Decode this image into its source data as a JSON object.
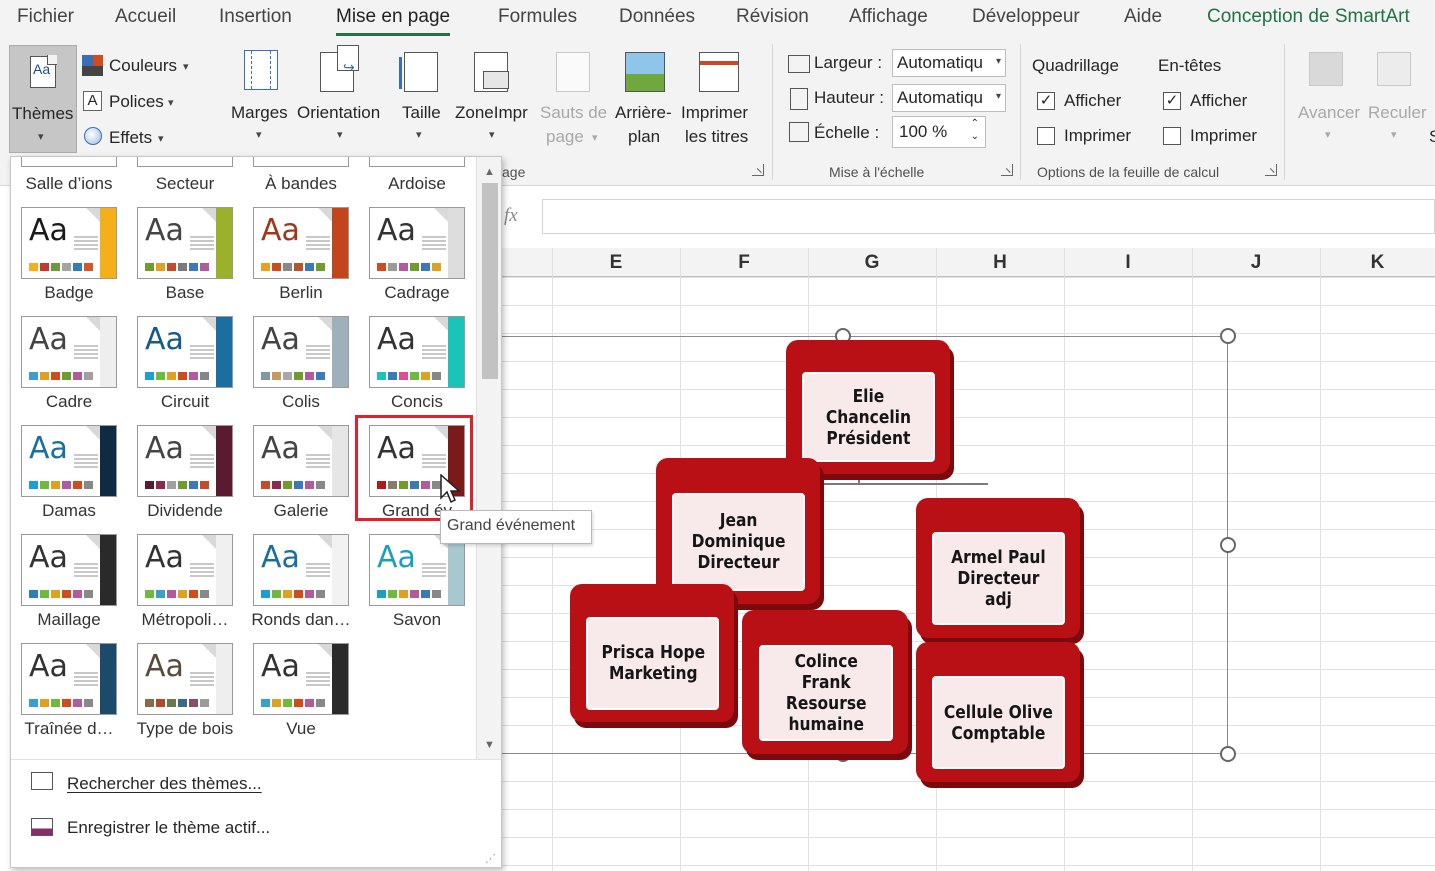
{
  "tabs": [
    {
      "label": "Fichier"
    },
    {
      "label": "Accueil"
    },
    {
      "label": "Insertion"
    },
    {
      "label": "Mise en page"
    },
    {
      "label": "Formules"
    },
    {
      "label": "Données"
    },
    {
      "label": "Révision"
    },
    {
      "label": "Affichage"
    },
    {
      "label": "Développeur"
    },
    {
      "label": "Aide"
    },
    {
      "label": "Conception de SmartArt"
    }
  ],
  "ribbon": {
    "themes": {
      "label": "Thèmes",
      "colors": "Couleurs",
      "fonts": "Polices",
      "effects": "Effets"
    },
    "page_setup": {
      "margins": "Marges",
      "orientation": "Orientation",
      "size": "Taille",
      "print_area": "ZoneImpr",
      "breaks_1": "Sauts de",
      "breaks_2": "page",
      "background_1": "Arrière-",
      "background_2": "plan",
      "print_titles_1": "Imprimer",
      "print_titles_2": "les titres",
      "group_label_tail": "age"
    },
    "scale": {
      "width_label": "Largeur :",
      "width_value": "Automatiqu",
      "height_label": "Hauteur :",
      "height_value": "Automatiqu",
      "scale_label": "Échelle :",
      "scale_value": "100 %",
      "group_label": "Mise à l'échelle"
    },
    "sheet_options": {
      "gridlines": "Quadrillage",
      "headings": "En-têtes",
      "view": "Afficher",
      "print": "Imprimer",
      "group_label": "Options de la feuille de calcul",
      "gridlines_view_checked": true,
      "gridlines_print_checked": false,
      "headings_view_checked": true,
      "headings_print_checked": false
    },
    "arrange": {
      "forward": "Avancer",
      "backward": "Reculer",
      "cut_letter": "S"
    }
  },
  "formula_bar": {
    "fx": "fx",
    "value": ""
  },
  "columns": [
    "E",
    "F",
    "G",
    "H",
    "I",
    "J",
    "K"
  ],
  "gallery": {
    "partial_row": [
      "Salle d’ions",
      "Secteur",
      "À bandes",
      "Ardoise"
    ],
    "themes": [
      {
        "name": "Badge",
        "aa_color": "#1a1a1a",
        "edge": "#f4b01a",
        "swatches": [
          "#f4b01a",
          "#c43b2b",
          "#6d9a3c",
          "#a4a4a4",
          "#2f7fb6",
          "#d7552a"
        ]
      },
      {
        "name": "Base",
        "aa_color": "#444444",
        "edge": "#9ab22a",
        "swatches": [
          "#6f9c2c",
          "#e0a020",
          "#c44b2b",
          "#7a7a7a",
          "#3a7ab8",
          "#b15b9e"
        ]
      },
      {
        "name": "Berlin",
        "aa_color": "#a0371c",
        "edge": "#c3451c",
        "swatches": [
          "#e8a020",
          "#d04c1c",
          "#888888",
          "#b4572a",
          "#3a7ab8",
          "#6f9c2c"
        ]
      },
      {
        "name": "Cadrage",
        "aa_color": "#333333",
        "edge": "#dddddd",
        "swatches": [
          "#d04c1c",
          "#9a9a9a",
          "#b15b9e",
          "#6f9c2c",
          "#3a7ab8",
          "#e0a020"
        ]
      },
      {
        "name": "Cadre",
        "aa_color": "#444444",
        "edge": "#eeeeee",
        "swatches": [
          "#3aa0c8",
          "#e0a020",
          "#d04c1c",
          "#6f9c2c",
          "#b15b9e",
          "#a0a0a0"
        ]
      },
      {
        "name": "Circuit",
        "aa_color": "#145a8c",
        "edge": "#1b6fa0",
        "swatches": [
          "#1b9ed6",
          "#6fb93f",
          "#e0a020",
          "#d04c1c",
          "#b15b9e",
          "#888888"
        ]
      },
      {
        "name": "Colis",
        "aa_color": "#444444",
        "edge": "#9eb0ba",
        "swatches": [
          "#7e9aa8",
          "#c69a5c",
          "#a8a8a8",
          "#6f9c2c",
          "#b15b9e",
          "#3a7ab8"
        ]
      },
      {
        "name": "Concis",
        "aa_color": "#333333",
        "edge": "#1cc3b8",
        "swatches": [
          "#1cc3b8",
          "#3a7ab8",
          "#e04c8c",
          "#6fb93f",
          "#e0a020",
          "#888888"
        ]
      },
      {
        "name": "Damas",
        "aa_color": "#1b6fa0",
        "edge": "#0f2b44",
        "swatches": [
          "#1b9ed6",
          "#6fb93f",
          "#e0a020",
          "#b15b9e",
          "#d04c1c",
          "#888888"
        ]
      },
      {
        "name": "Dividende",
        "aa_color": "#444444",
        "edge": "#5a1a30",
        "swatches": [
          "#5a1a30",
          "#8a2b4c",
          "#a0a0a0",
          "#6f9c2c",
          "#3a7ab8",
          "#c44b2b"
        ]
      },
      {
        "name": "Galerie",
        "aa_color": "#444444",
        "edge": "#e6e6e6",
        "swatches": [
          "#c44b2b",
          "#8a2b4c",
          "#6f9c2c",
          "#3a7ab8",
          "#b15b9e",
          "#888888"
        ]
      },
      {
        "name": "Grand événement",
        "label": "Grand év",
        "aa_color": "#333333",
        "edge": "#7a1a1a",
        "swatches": [
          "#b01a1a",
          "#8a7a6a",
          "#6f9c2c",
          "#3a7ab8",
          "#b15b9e",
          "#888888"
        ]
      },
      {
        "name": "Maillage",
        "aa_color": "#333333",
        "edge": "#2a2a2a",
        "swatches": [
          "#2f7fb6",
          "#6fb93f",
          "#e0a020",
          "#d04c1c",
          "#b15b9e",
          "#888888"
        ]
      },
      {
        "name": "Métropoli…",
        "aa_color": "#333333",
        "edge": "#f0f0f0",
        "swatches": [
          "#6fb93f",
          "#3aa0c8",
          "#b15b9e",
          "#e0a020",
          "#d04c1c",
          "#888888"
        ]
      },
      {
        "name": "Ronds dan…",
        "aa_color": "#1b6fa0",
        "edge": "#f2f2f2",
        "swatches": [
          "#1b9ed6",
          "#6fb93f",
          "#e0a020",
          "#d04c1c",
          "#b15b9e",
          "#888888"
        ]
      },
      {
        "name": "Savon",
        "aa_color": "#1b9ec0",
        "edge": "#a8c8d0",
        "swatches": [
          "#1b9ec0",
          "#6fb93f",
          "#e0a020",
          "#b15b9e",
          "#3a7ab8",
          "#888888"
        ]
      },
      {
        "name": "Traînée d…",
        "aa_color": "#333333",
        "edge": "#1b4a6a",
        "swatches": [
          "#3aa0c8",
          "#e0a020",
          "#6fb93f",
          "#d04c1c",
          "#b15b9e",
          "#888888"
        ]
      },
      {
        "name": "Type de bois",
        "aa_color": "#5a4a3a",
        "edge": "#eeeeee",
        "swatches": [
          "#8a6a4a",
          "#b04a2a",
          "#6a7a4a",
          "#3a6a8a",
          "#8a4a6a",
          "#9a9a9a"
        ]
      },
      {
        "name": "Vue",
        "aa_color": "#333333",
        "edge": "#2a2a2a",
        "swatches": [
          "#3aa0c8",
          "#e0a020",
          "#6fb93f",
          "#d04c1c",
          "#b15b9e",
          "#888888"
        ]
      }
    ],
    "search_label": "Rechercher des thèmes...",
    "save_label": "Enregistrer le thème actif..."
  },
  "tooltip": "Grand événement",
  "org_chart": {
    "nodes": [
      {
        "text": "Elie Chancelin\nPrésident"
      },
      {
        "text": "Jean\nDominique\nDirecteur"
      },
      {
        "text": "Armel Paul\nDirecteur adj"
      },
      {
        "text": "Prisca Hope\nMarketing"
      },
      {
        "text": "Colince Frank\nResourse\nhumaine"
      },
      {
        "text": "Cellule Olive\nComptable"
      }
    ],
    "colors": {
      "box": "#b91015",
      "face": "#f8eaea"
    }
  }
}
